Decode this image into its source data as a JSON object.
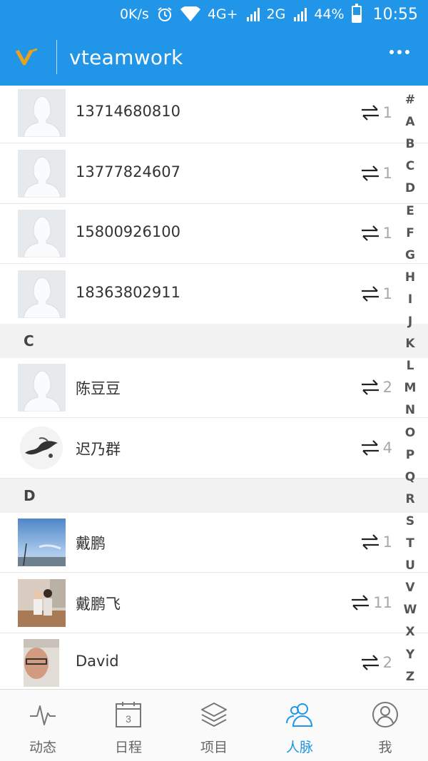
{
  "status_bar": {
    "net_speed": "0K/s",
    "network1": "4G+",
    "network2": "2G",
    "battery_text": "44%",
    "battery_level": 0.44,
    "time": "10:55"
  },
  "app_bar": {
    "title": "vteamwork",
    "logo_icon": "vteamwork-logo-icon",
    "menu_icon": "more-dots-icon"
  },
  "contacts_top": [
    {
      "name": "13714680810",
      "count": "1",
      "avatar": "default"
    },
    {
      "name": "13777824607",
      "count": "1",
      "avatar": "default"
    },
    {
      "name": "15800926100",
      "count": "1",
      "avatar": "default"
    },
    {
      "name": "18363802911",
      "count": "1",
      "avatar": "default"
    }
  ],
  "section_c": {
    "letter": "C"
  },
  "contacts_c": [
    {
      "name": "陈豆豆",
      "count": "2",
      "avatar": "default"
    },
    {
      "name": "迟乃群",
      "count": "4",
      "avatar": "ink-painting"
    }
  ],
  "section_d": {
    "letter": "D"
  },
  "contacts_d": [
    {
      "name": "戴鹏",
      "count": "1",
      "avatar": "sky-photo"
    },
    {
      "name": "戴鹏飞",
      "count": "11",
      "avatar": "children-photo"
    },
    {
      "name": "David",
      "count": "2",
      "avatar": "man-photo"
    }
  ],
  "index_letters": [
    "#",
    "A",
    "B",
    "C",
    "D",
    "E",
    "F",
    "G",
    "H",
    "I",
    "J",
    "K",
    "L",
    "M",
    "N",
    "O",
    "P",
    "Q",
    "R",
    "S",
    "T",
    "U",
    "V",
    "W",
    "X",
    "Y",
    "Z"
  ],
  "bottom_nav": [
    {
      "label": "动态",
      "icon": "pulse-icon",
      "active": false
    },
    {
      "label": "日程",
      "icon": "calendar-icon",
      "active": false,
      "calendar_day": "3"
    },
    {
      "label": "项目",
      "icon": "layers-icon",
      "active": false
    },
    {
      "label": "人脉",
      "icon": "contacts-icon",
      "active": true
    },
    {
      "label": "我",
      "icon": "profile-icon",
      "active": false
    }
  ],
  "colors": {
    "primary": "#2196e8",
    "nav_inactive": "#666666",
    "count_gray": "#a8a8a8"
  }
}
